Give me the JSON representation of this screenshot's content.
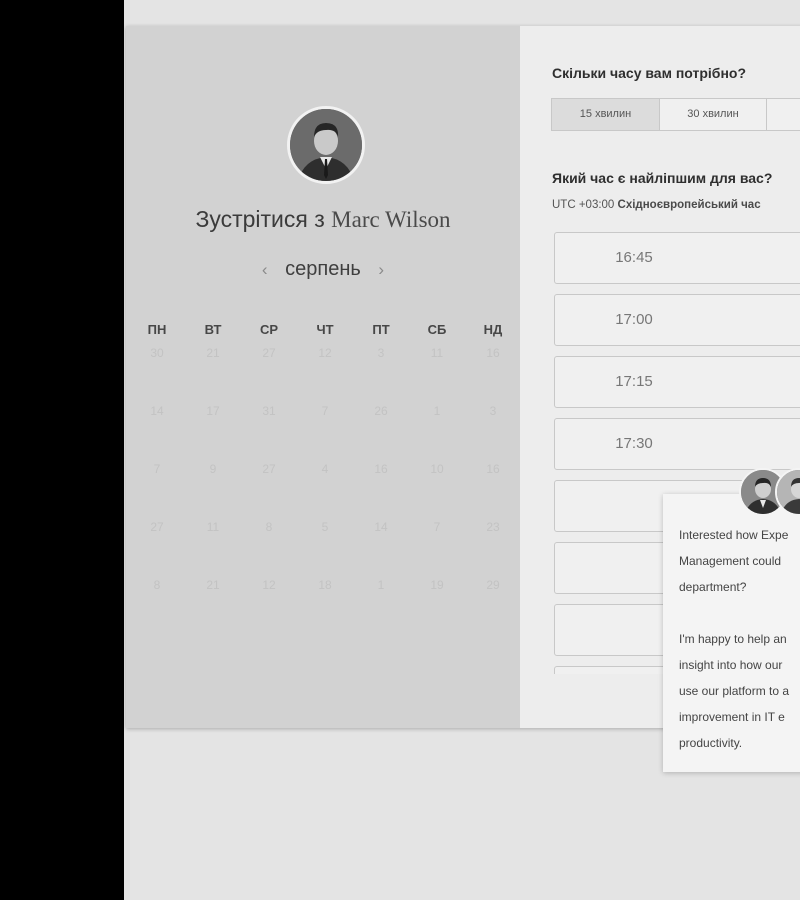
{
  "scheduler": {
    "host_title_prefix": "Зустрітися з",
    "host_name": "Marc Wilson",
    "month": "серпень",
    "prev_arrow": "‹",
    "next_arrow": "›",
    "weekdays": [
      "ПН",
      "ВТ",
      "СР",
      "ЧТ",
      "ПТ",
      "СБ",
      "НД"
    ],
    "weeks": [
      [
        "30",
        "21",
        "27",
        "12",
        "3",
        "11",
        "16"
      ],
      [
        "14",
        "17",
        "31",
        "7",
        "26",
        "1",
        "3"
      ],
      [
        "7",
        "9",
        "27",
        "4",
        "16",
        "10",
        "16"
      ],
      [
        "27",
        "11",
        "8",
        "5",
        "14",
        "7",
        "23"
      ],
      [
        "8",
        "21",
        "12",
        "18",
        "1",
        "19",
        "29"
      ]
    ],
    "duration_question": "Скільки часу вам потрібно?",
    "durations": [
      "15 хвилин",
      "30 хвилин",
      ""
    ],
    "selected_duration": "15 хвилин",
    "time_question": "Який час є найліпшим для вас?",
    "timezone_offset": "UTC +03:00",
    "timezone_name": "Східноєвропейський час",
    "slots": [
      "16:45",
      "17:00",
      "17:15",
      "17:30",
      "",
      "",
      "",
      ""
    ]
  },
  "chat_popup": {
    "lines_1": [
      "Interested how Expe",
      "Management could",
      "department?"
    ],
    "lines_2": [
      "I'm happy to help an",
      "insight into how our",
      "use our platform to a",
      "improvement in IT e",
      "productivity."
    ]
  },
  "colors": {
    "left_panel": "#d2d2d2",
    "right_panel": "#ededed",
    "page_background": "#e4e4e4",
    "outside": "#000000"
  },
  "icons": {
    "logo": "speech-bubble-logo-icon",
    "avatar": "user-avatar"
  }
}
